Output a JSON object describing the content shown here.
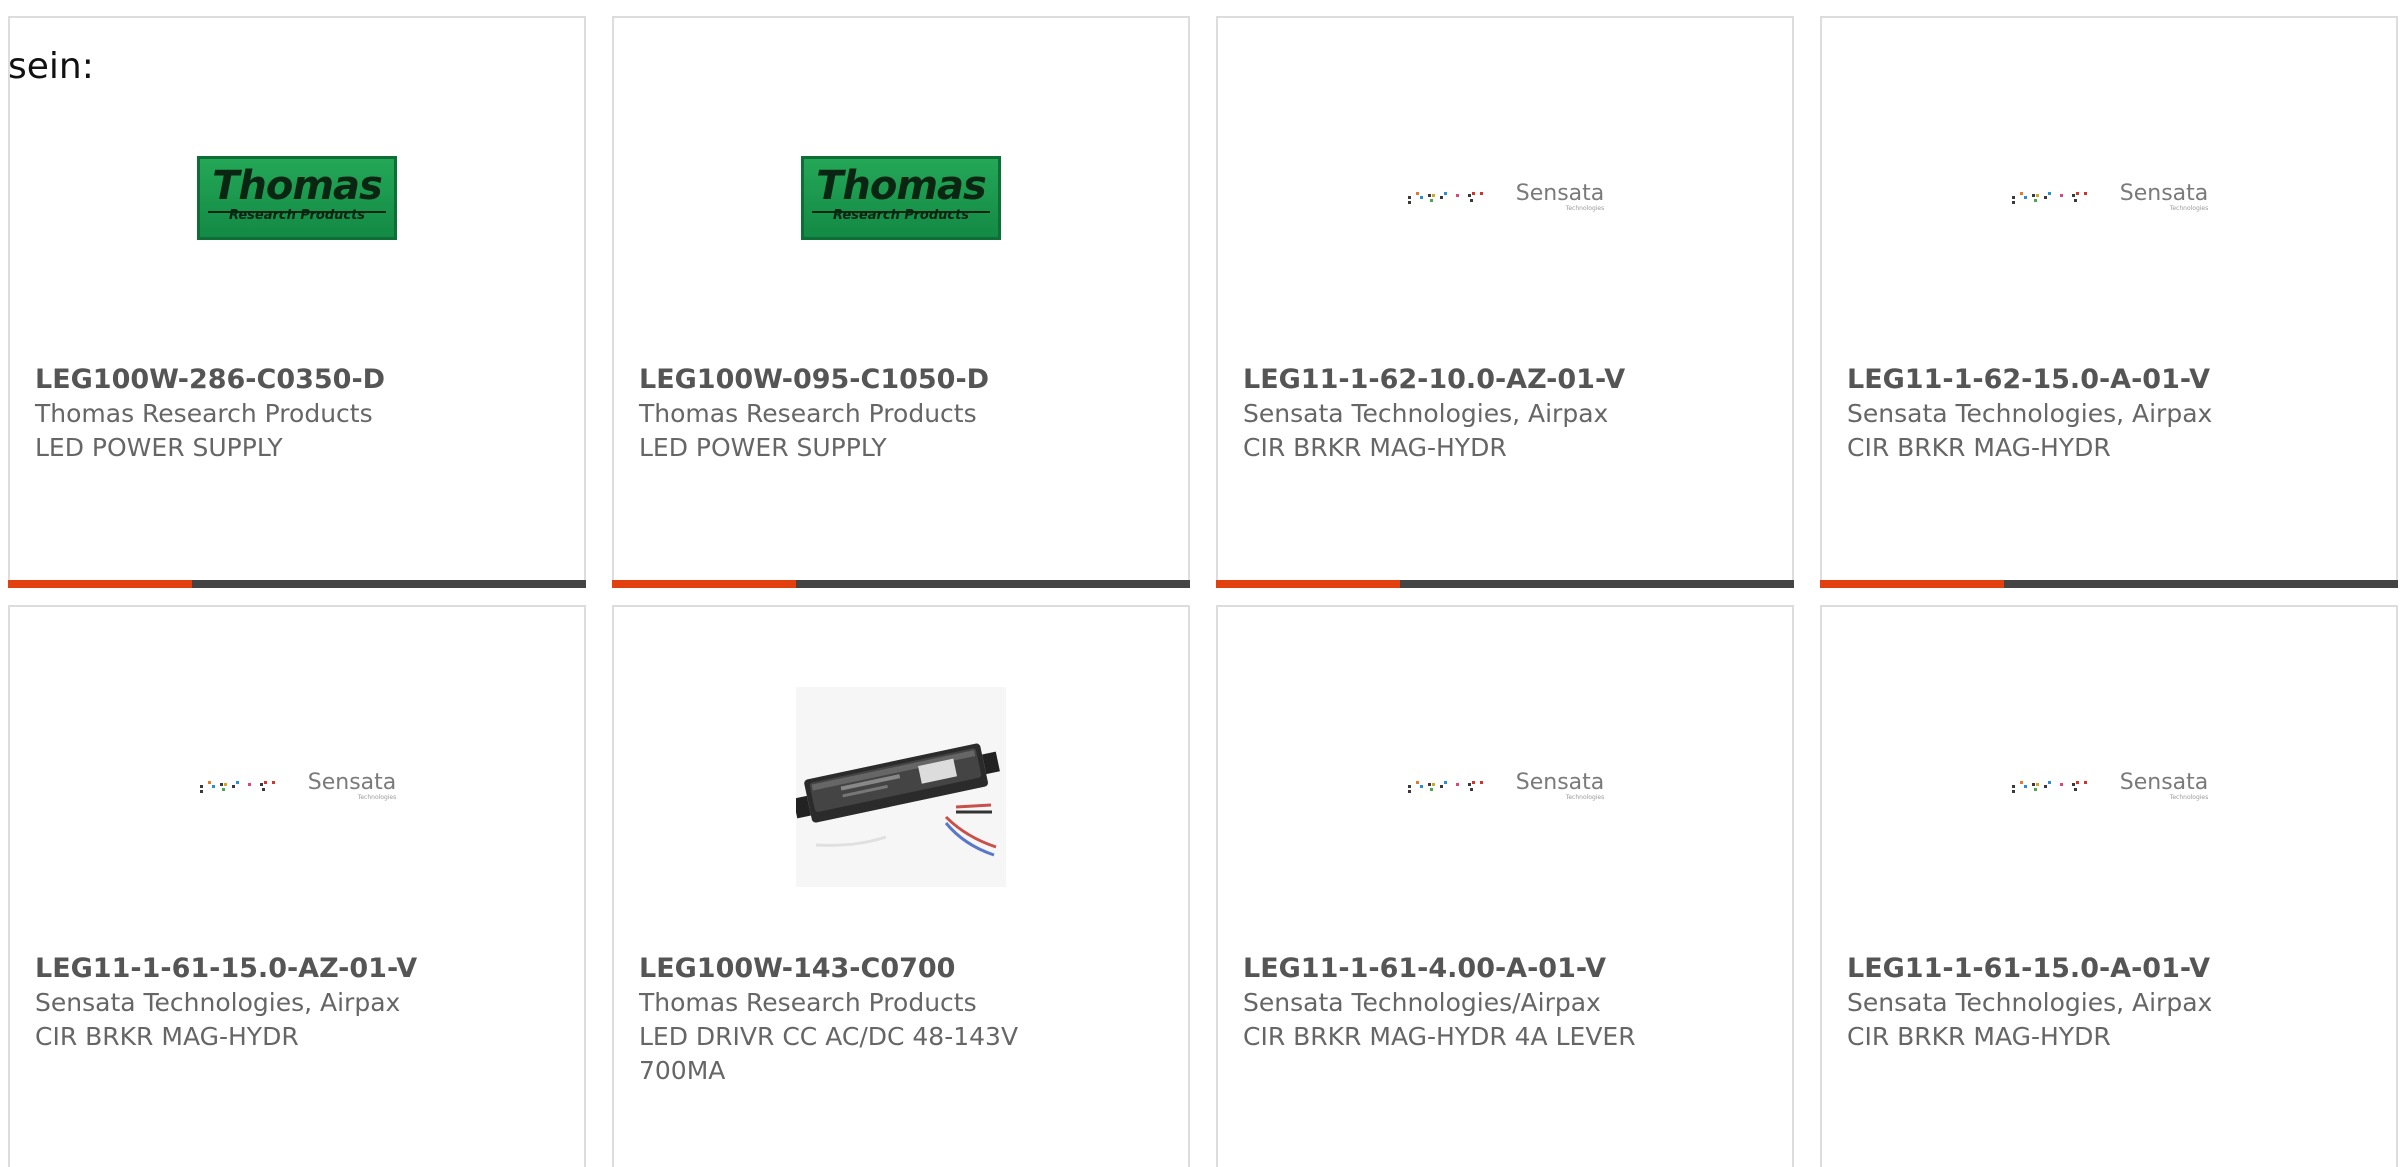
{
  "stray_text": "sein:",
  "brand_colors": {
    "accent_bar": "#e2400f",
    "bar_dark": "#444444",
    "thomas_green": "#1b9a4c"
  },
  "cards": [
    {
      "part_number": "LEG100W-286-C0350-D",
      "manufacturer": "Thomas Research Products",
      "description": "LED POWER SUPPLY",
      "image": "thomas-research-products-logo",
      "logo_text": "Thomas",
      "logo_subtext": "Research Products",
      "has_accent_bar": true
    },
    {
      "part_number": "LEG100W-095-C1050-D",
      "manufacturer": "Thomas Research Products",
      "description": "LED POWER SUPPLY",
      "image": "thomas-research-products-logo",
      "logo_text": "Thomas",
      "logo_subtext": "Research Products",
      "has_accent_bar": true
    },
    {
      "part_number": "LEG11-1-62-10.0-AZ-01-V",
      "manufacturer": "Sensata Technologies, Airpax",
      "description": "CIR BRKR MAG-HYDR",
      "image": "sensata-logo",
      "logo_text": "Sensata",
      "logo_subtext": "Technologies",
      "has_accent_bar": true
    },
    {
      "part_number": "LEG11-1-62-15.0-A-01-V",
      "manufacturer": "Sensata Technologies, Airpax",
      "description": "CIR BRKR MAG-HYDR",
      "image": "sensata-logo",
      "logo_text": "Sensata",
      "logo_subtext": "Technologies",
      "has_accent_bar": true
    },
    {
      "part_number": "LEG11-1-61-15.0-AZ-01-V",
      "manufacturer": "Sensata Technologies, Airpax",
      "description": "CIR BRKR MAG-HYDR",
      "image": "sensata-logo",
      "logo_text": "Sensata",
      "logo_subtext": "Technologies",
      "has_accent_bar": false
    },
    {
      "part_number": "LEG100W-143-C0700",
      "manufacturer": "Thomas Research Products",
      "description": "LED DRIVR CC AC/DC 48-143V 700MA",
      "image": "led-driver-photo",
      "has_accent_bar": false
    },
    {
      "part_number": "LEG11-1-61-4.00-A-01-V",
      "manufacturer": "Sensata Technologies/Airpax",
      "description": "CIR BRKR MAG-HYDR 4A LEVER",
      "image": "sensata-logo",
      "logo_text": "Sensata",
      "logo_subtext": "Technologies",
      "has_accent_bar": false
    },
    {
      "part_number": "LEG11-1-61-15.0-A-01-V",
      "manufacturer": "Sensata Technologies, Airpax",
      "description": "CIR BRKR MAG-HYDR",
      "image": "sensata-logo",
      "logo_text": "Sensata",
      "logo_subtext": "Technologies",
      "has_accent_bar": false
    }
  ]
}
